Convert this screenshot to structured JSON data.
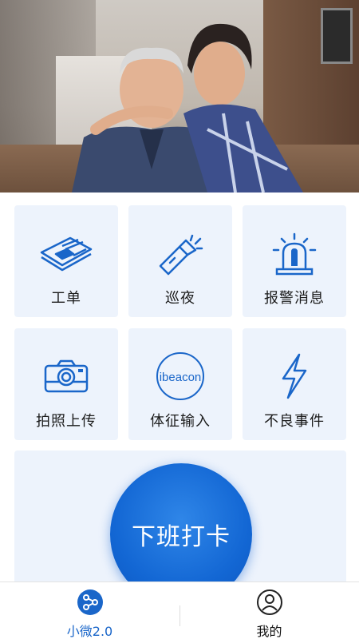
{
  "hero": {
    "alt": "elderly-couple-photo"
  },
  "tiles": [
    {
      "label": "工单",
      "icon": "newspaper-icon"
    },
    {
      "label": "巡夜",
      "icon": "flashlight-icon"
    },
    {
      "label": "报警消息",
      "icon": "alarm-light-icon"
    },
    {
      "label": "拍照上传",
      "icon": "camera-icon"
    },
    {
      "label": "体征输入",
      "icon": "ibeacon-icon",
      "icon_text": "ibeacon"
    },
    {
      "label": "不良事件",
      "icon": "lightning-icon"
    }
  ],
  "punch": {
    "label": "下班打卡"
  },
  "tabbar": {
    "items": [
      {
        "label": "小微2.0",
        "icon": "share-nodes-icon",
        "active": true
      },
      {
        "label": "我的",
        "icon": "user-icon",
        "active": false
      }
    ]
  },
  "colors": {
    "accent": "#1367d4",
    "tile_bg": "#edf3fc",
    "icon_stroke": "#1a66c9"
  }
}
